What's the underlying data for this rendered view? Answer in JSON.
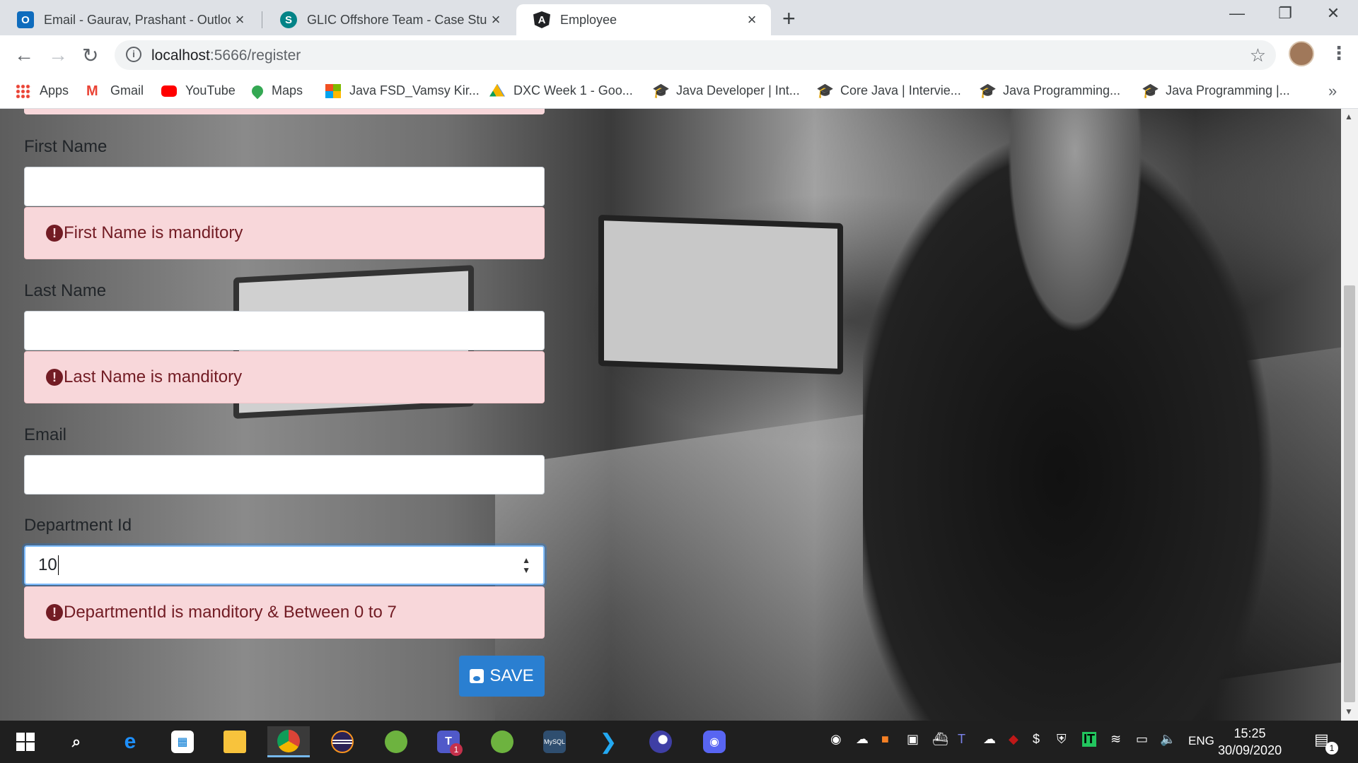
{
  "tabs": [
    {
      "title": "Email - Gaurav, Prashant - Outlook",
      "icon": "outlook-icon",
      "color": "#0f6cbd"
    },
    {
      "title": "GLIC Offshore Team - Case Study",
      "icon": "sharepoint-icon",
      "color": "#038387"
    },
    {
      "title": "Employee",
      "icon": "angular-icon",
      "color": "#202124"
    }
  ],
  "address": {
    "host": "localhost",
    "rest": ":5666/register"
  },
  "bookmarks": [
    {
      "label": "Apps",
      "icon": "apps-grid-icon"
    },
    {
      "label": "Gmail",
      "icon": "gmail-icon"
    },
    {
      "label": "YouTube",
      "icon": "youtube-icon"
    },
    {
      "label": "Maps",
      "icon": "maps-icon"
    },
    {
      "label": "Java FSD_Vamsy Kir...",
      "icon": "microsoft-icon"
    },
    {
      "label": "DXC Week 1 - Goo...",
      "icon": "google-drive-icon"
    },
    {
      "label": "Java Developer | Int...",
      "icon": "graduation-cap-icon"
    },
    {
      "label": "Core Java | Intervie...",
      "icon": "graduation-cap-icon"
    },
    {
      "label": "Java Programming...",
      "icon": "graduation-cap-icon"
    },
    {
      "label": "Java Programming |...",
      "icon": "graduation-cap-icon"
    }
  ],
  "form": {
    "first_name_label": "First Name",
    "first_name_value": "",
    "first_name_error": "First Name is manditory",
    "last_name_label": "Last Name",
    "last_name_value": "",
    "last_name_error": "Last Name is manditory",
    "email_label": "Email",
    "email_value": "",
    "department_label": "Department Id",
    "department_value": "10",
    "department_error": "DepartmentId is manditory & Between 0 to 7",
    "save_label": "SAVE"
  },
  "taskbar": {
    "time": "15:25",
    "date": "30/09/2020",
    "language": "ENG",
    "notification_count": "1",
    "teams_badge": "1"
  }
}
